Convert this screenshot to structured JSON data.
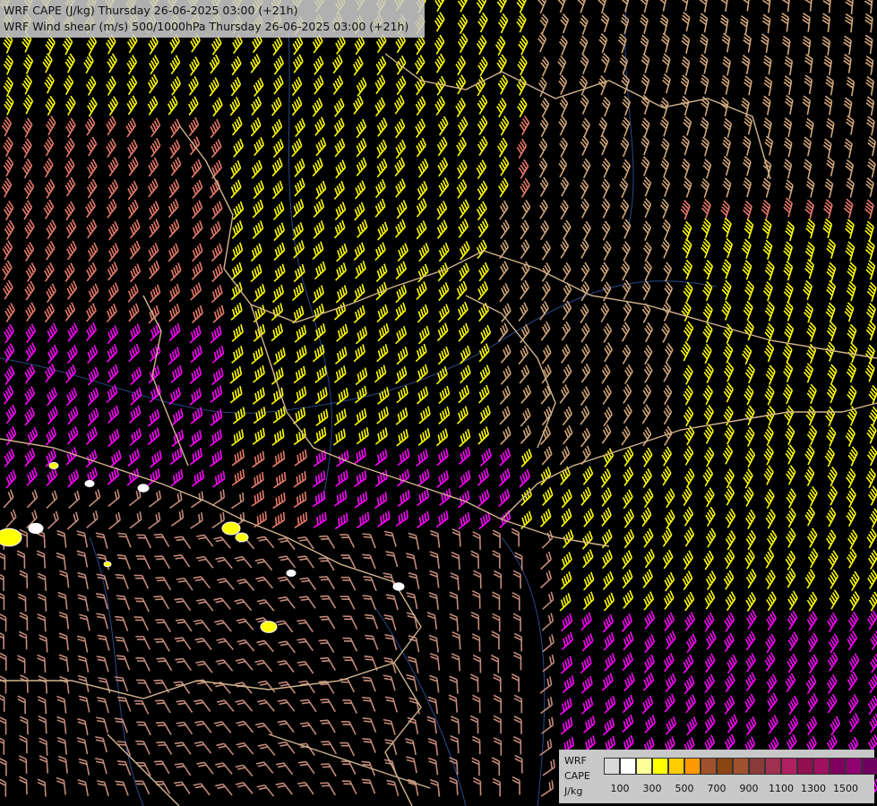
{
  "titles": {
    "line1": "WRF CAPE (J/kg) Thursday 26-06-2025 03:00 (+21h)",
    "line2": "WRF Wind shear (m/s) 500/1000hPa Thursday 26-06-2025 03:00 (+21h)"
  },
  "legend": {
    "model": "WRF",
    "variable": "CAPE",
    "unit": "J/kg",
    "tick_labels": [
      "100",
      "300",
      "500",
      "700",
      "900",
      "1100",
      "1300",
      "1500"
    ],
    "colors": [
      "#d9d9d9",
      "#ffffff",
      "#ffff99",
      "#ffff00",
      "#ffcc00",
      "#ff9900",
      "#a0522d",
      "#8b4513",
      "#a0522d",
      "#8b3a3a",
      "#a03050",
      "#b02060",
      "#901050",
      "#a01060",
      "#800060",
      "#900070",
      "#700060"
    ]
  },
  "barb_colors": {
    "yellow": "#ffff00",
    "tan": "#d2a679",
    "salmon": "#e87a6a",
    "magenta": "#ff00ff",
    "dusty_rose": "#c48a7a",
    "lilac": "#c080ff"
  },
  "map_colors": {
    "background": "#000000",
    "country_borders": "#d2b48c",
    "rivers": "#2a4a8a",
    "cape_patch_yellow": "#ffff00",
    "cape_patch_white": "#ffffff"
  }
}
